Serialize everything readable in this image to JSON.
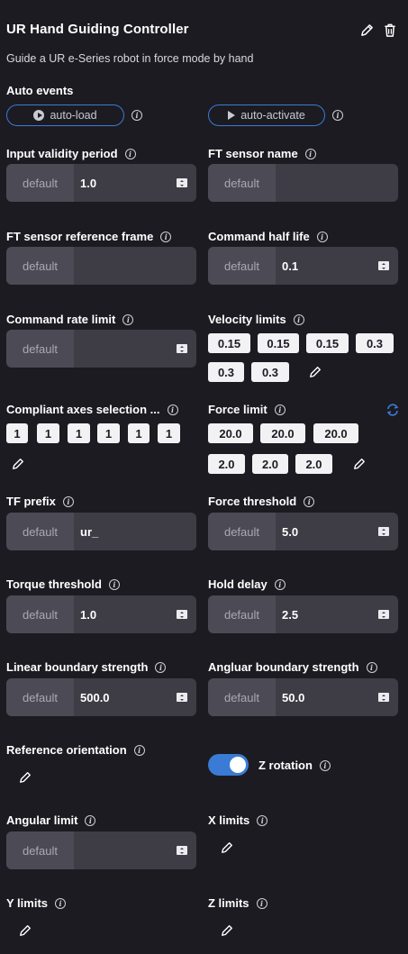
{
  "header": {
    "title": "UR Hand Guiding Controller",
    "subtitle": "Guide a UR e-Series robot in force mode by hand"
  },
  "auto_events": {
    "label": "Auto events",
    "load_label": "auto-load",
    "activate_label": "auto-activate"
  },
  "default_label": "default",
  "fields": {
    "input_validity_period": {
      "label": "Input validity period",
      "value": "1.0"
    },
    "ft_sensor_name": {
      "label": "FT sensor name",
      "value": ""
    },
    "ft_sensor_reference_frame": {
      "label": "FT sensor reference frame",
      "value": ""
    },
    "command_half_life": {
      "label": "Command half life",
      "value": "0.1"
    },
    "command_rate_limit": {
      "label": "Command rate limit",
      "value": ""
    },
    "velocity_limits": {
      "label": "Velocity limits",
      "values": [
        "0.15",
        "0.15",
        "0.15",
        "0.3",
        "0.3",
        "0.3"
      ]
    },
    "compliant_axes": {
      "label": "Compliant axes selection ...",
      "values": [
        "1",
        "1",
        "1",
        "1",
        "1",
        "1"
      ]
    },
    "force_limit": {
      "label": "Force limit",
      "values": [
        "20.0",
        "20.0",
        "20.0",
        "2.0",
        "2.0",
        "2.0"
      ]
    },
    "tf_prefix": {
      "label": "TF prefix",
      "value": "ur_"
    },
    "force_threshold": {
      "label": "Force threshold",
      "value": "5.0"
    },
    "torque_threshold": {
      "label": "Torque threshold",
      "value": "1.0"
    },
    "hold_delay": {
      "label": "Hold delay",
      "value": "2.5"
    },
    "linear_boundary_strength": {
      "label": "Linear boundary strength",
      "value": "500.0"
    },
    "angular_boundary_strength": {
      "label": "Angluar boundary strength",
      "value": "50.0"
    },
    "reference_orientation": {
      "label": "Reference orientation"
    },
    "z_rotation": {
      "label": "Z rotation",
      "enabled": true
    },
    "angular_limit": {
      "label": "Angular limit",
      "value": ""
    },
    "x_limits": {
      "label": "X limits"
    },
    "y_limits": {
      "label": "Y limits"
    },
    "z_limits": {
      "label": "Z limits"
    }
  },
  "colors": {
    "background": "#1c1b22",
    "accent": "#3a7bd5",
    "field": "#3e3d46",
    "default_box": "#4c4b55"
  },
  "icons": {
    "edit": "pencil-icon",
    "delete": "trash-icon",
    "info": "info-icon",
    "reset": "refresh-icon",
    "spinner": "stepper-icon"
  }
}
